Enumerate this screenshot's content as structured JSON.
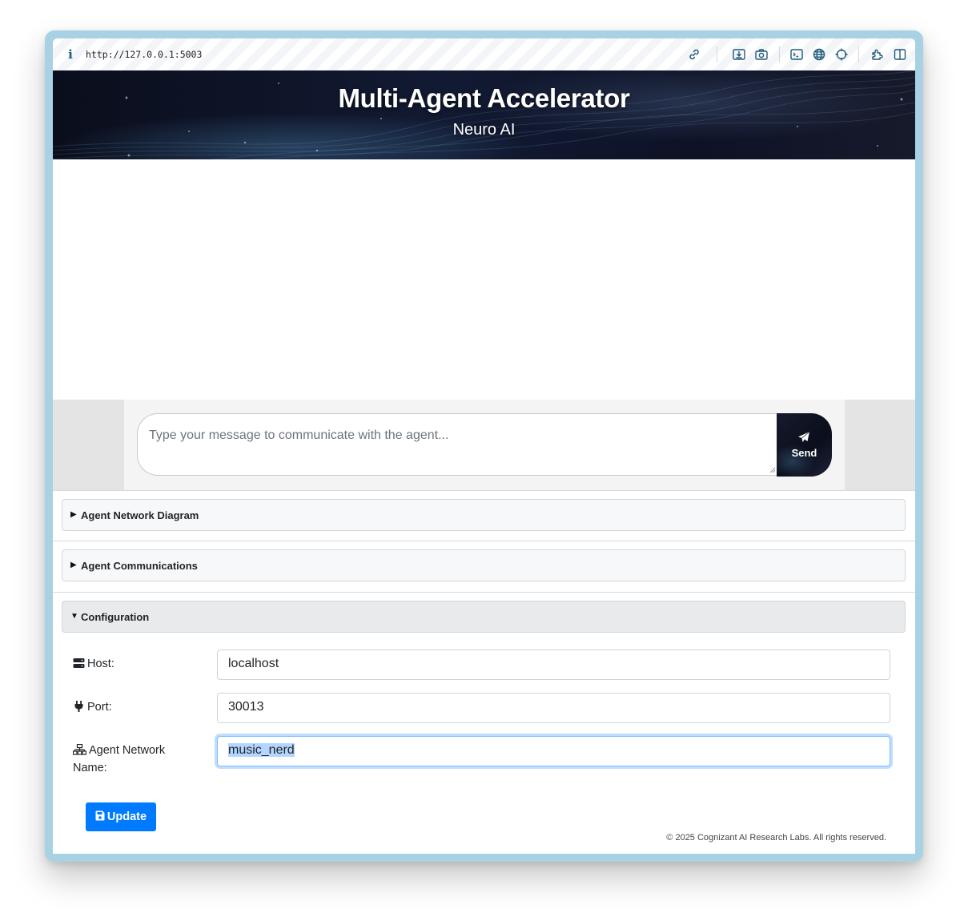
{
  "browser": {
    "url": "http://127.0.0.1:5003",
    "toolbar_icons": [
      "link-icon",
      "download-icon",
      "camera-icon",
      "terminal-icon",
      "globe-icon",
      "crosshair-icon",
      "extension-icon",
      "sidebar-icon"
    ]
  },
  "header": {
    "title": "Multi-Agent Accelerator",
    "subtitle": "Neuro AI"
  },
  "chat": {
    "placeholder": "Type your message to communicate with the agent...",
    "send_label": "Send"
  },
  "sections": {
    "diagram": {
      "title": "Agent Network Diagram",
      "expanded": false
    },
    "communications": {
      "title": "Agent Communications",
      "expanded": false
    },
    "configuration": {
      "title": "Configuration",
      "expanded": true
    }
  },
  "config": {
    "host_label": "Host:",
    "host_value": "localhost",
    "port_label": "Port:",
    "port_value": "30013",
    "network_label": "Agent Network Name:",
    "network_value": "music_nerd",
    "update_label": "Update"
  },
  "footer": {
    "copyright": "© 2025 Cognizant AI Research Labs. All rights reserved."
  },
  "colors": {
    "accent": "#007bff",
    "frame": "#a8d2e4",
    "hero_dark": "#0d1226"
  }
}
